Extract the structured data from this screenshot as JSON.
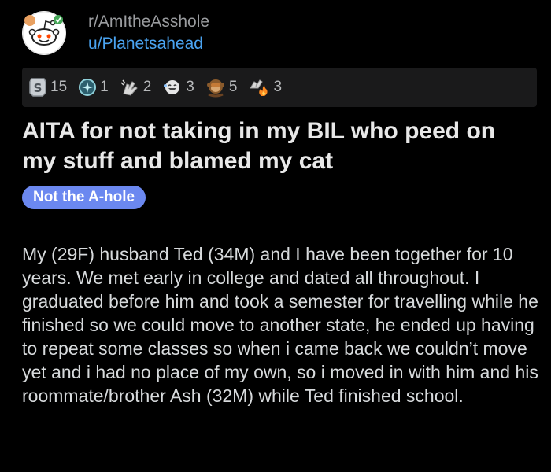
{
  "post": {
    "subreddit": "r/AmItheAsshole",
    "username": "u/Planetsahead",
    "title": "AITA for not taking in my BIL who peed on my stuff and blamed my cat",
    "flair": "Not the A-hole",
    "body": "My (29F) husband Ted (34M) and I have been together for 10 years. We met early in college and dated all throughout. I graduated before him and took a semester for travelling while he finished so we could move to another state, he ended up having to repeat some classes so when i came back we couldn’t move yet and i had no place of my own, so i moved in with him and his roommate/brother Ash (32M) while Ted finished school."
  },
  "awards": [
    {
      "icon": "silver-award-icon",
      "count": "15"
    },
    {
      "icon": "helpful-award-icon",
      "count": "1"
    },
    {
      "icon": "clap-award-icon",
      "count": "2"
    },
    {
      "icon": "laughing-award-icon",
      "count": "3"
    },
    {
      "icon": "monkey-award-icon",
      "count": "5"
    },
    {
      "icon": "fire-award-icon",
      "count": "3"
    }
  ],
  "colors": {
    "background": "#000000",
    "username": "#4aa3f0",
    "flair": "#6b88f0"
  }
}
